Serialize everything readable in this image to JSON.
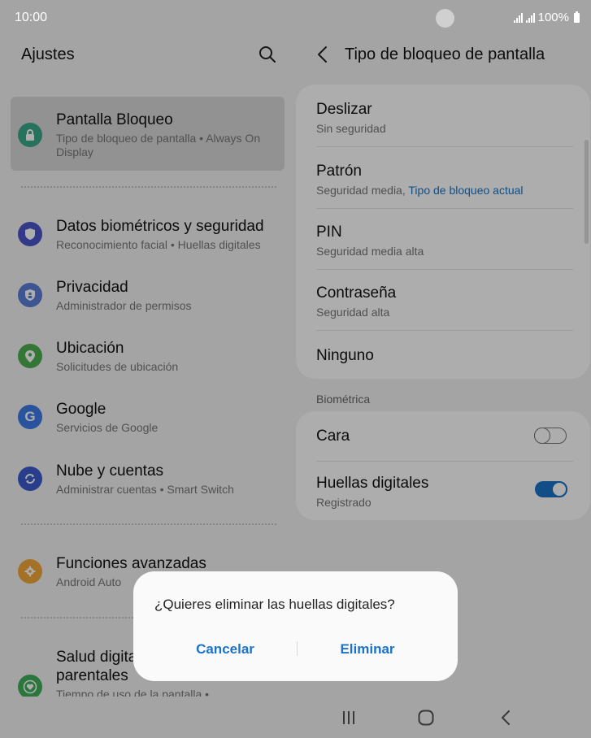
{
  "status_bar": {
    "time": "10:00",
    "battery": "100%"
  },
  "left_panel": {
    "title": "Ajustes",
    "items": [
      {
        "title": "Pantalla Bloqueo",
        "subtitle": "Tipo de bloqueo de pantalla  •  Always On Display",
        "icon": "lock-icon",
        "color": "#3aa88a"
      },
      {
        "title": "Datos biométricos y seguridad",
        "subtitle": "Reconocimiento facial  •  Huellas digitales",
        "icon": "shield-icon",
        "color": "#4b55c9"
      },
      {
        "title": "Privacidad",
        "subtitle": "Administrador de permisos",
        "icon": "privacy-shield-icon",
        "color": "#5a7fd6"
      },
      {
        "title": "Ubicación",
        "subtitle": "Solicitudes de ubicación",
        "icon": "location-pin-icon",
        "color": "#4caf50"
      },
      {
        "title": "Google",
        "subtitle": "Servicios de Google",
        "icon": "google-icon",
        "color": "#3d7be6"
      },
      {
        "title": "Nube y cuentas",
        "subtitle": "Administrar cuentas  •  Smart Switch",
        "icon": "sync-icon",
        "color": "#3b5ccf"
      },
      {
        "title": "Funciones avanzadas",
        "subtitle": "Android Auto",
        "icon": "puzzle-gear-icon",
        "color": "#f2a83a"
      },
      {
        "title": "Salud digital y controles parentales",
        "title_line1": "Salud digital y controles",
        "title_line2": "parentales",
        "subtitle": "Tiempo de uso de la pantalla  •",
        "icon": "heart-circle-icon",
        "color": "#3fae5a"
      }
    ]
  },
  "right_panel": {
    "title": "Tipo de bloqueo de pantalla",
    "options": [
      {
        "title": "Deslizar",
        "subtitle": "Sin seguridad"
      },
      {
        "title": "Patrón",
        "subtitle": "Seguridad media,",
        "subtitle_accent": "Tipo de bloqueo actual"
      },
      {
        "title": "PIN",
        "subtitle": "Seguridad media alta"
      },
      {
        "title": "Contraseña",
        "subtitle": "Seguridad alta"
      },
      {
        "title": "Ninguno",
        "subtitle": ""
      }
    ],
    "biometric_section_label": "Biométrica",
    "biometrics": [
      {
        "title": "Cara",
        "subtitle": "",
        "enabled": false
      },
      {
        "title": "Huellas digitales",
        "subtitle": "Registrado",
        "enabled": true
      }
    ]
  },
  "dialog": {
    "message": "¿Quieres eliminar las huellas digitales?",
    "cancel_label": "Cancelar",
    "confirm_label": "Eliminar"
  },
  "colors": {
    "accent": "#1a73c9",
    "background": "#f2f2f2",
    "overlay": "rgba(0,0,0,0.32)"
  }
}
